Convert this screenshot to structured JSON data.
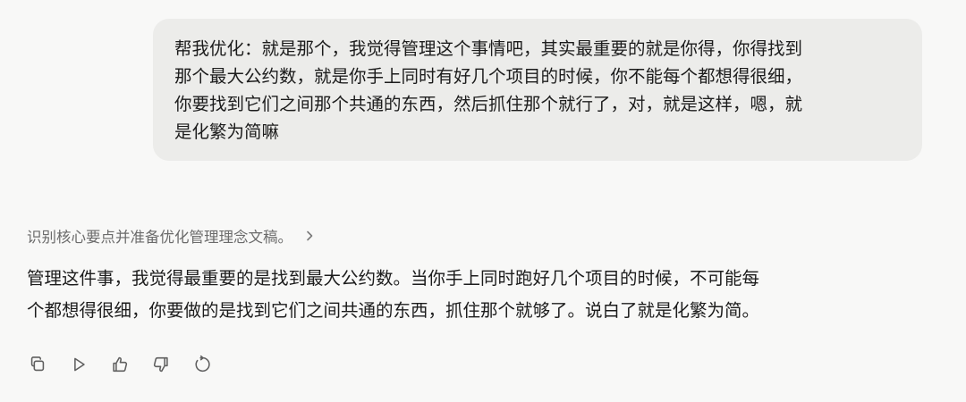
{
  "user_message": {
    "text": "帮我优化：就是那个，我觉得管理这个事情吧，其实最重要的就是你得，你得找到\n那个最大公约数，就是你手上同时有好几个项目的时候，你不能每个都想得很细，\n你要找到它们之间那个共通的东西，然后抓住那个就行了，对，就是这样，嗯，就\n是化繁为简嘛"
  },
  "assistant": {
    "thinking_summary": "识别核心要点并准备优化管理理念文稿。",
    "answer": "管理这件事，我觉得最重要的是找到最大公约数。当你手上同时跑好几个项目的时候，不可能每\n个都想得很细，你要做的是找到它们之间共通的东西，抓住那个就够了。说白了就是化繁为简。"
  },
  "actions": {
    "icons": [
      "copy-icon",
      "play-icon",
      "thumbs-up-icon",
      "thumbs-down-icon",
      "retry-icon"
    ]
  },
  "colors": {
    "background": "#f8f8f7",
    "bubble": "#ececea",
    "muted_text": "#6b6b6b",
    "icon": "#5f5f5f"
  }
}
